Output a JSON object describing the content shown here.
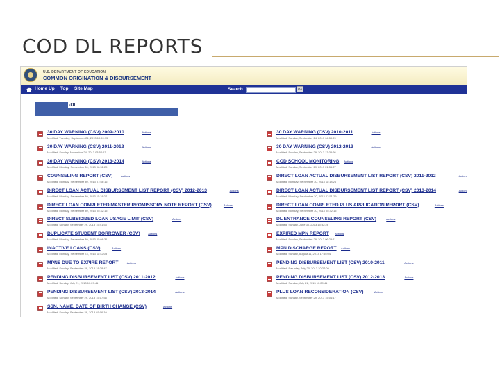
{
  "slide": {
    "title": "COD DL REPORTS"
  },
  "site": {
    "department": "U.S. DEPARTMENT OF EDUCATION",
    "system_name": "COMMON ORIGINATION & DISBURSEMENT",
    "nav": [
      "Home",
      "Up",
      "Top",
      "Site Map"
    ],
    "search_label": "Search",
    "search_value": "",
    "go_label": "Go"
  },
  "section": {
    "title": "-DL"
  },
  "colors": {
    "nav_bar": "#1f3296",
    "link": "#1a2b8c",
    "banner": "#fffbe2",
    "redacted_block": "#3f5fa8",
    "title_rule": "#c8aa6e"
  },
  "icons": {
    "report": "report-doc-icon",
    "home": "home-icon",
    "seal": "department-seal-icon"
  },
  "reports_left": [
    {
      "name": "30 DAY WARNING (CSV) 2009-2010",
      "actions": "Actions",
      "modified": "Modified: Tuesday, September 24, 2013 10:59:15"
    },
    {
      "name": "30 DAY WARNING (CSV) 2011-2012",
      "actions": "Actions",
      "modified": "Modified: Sunday, November 24, 2013 03:54:13"
    },
    {
      "name": "30 DAY WARNING (CSV) 2013-2014",
      "actions": "Actions",
      "modified": "Modified: Monday, September 30, 2013 08:31:29"
    },
    {
      "name": "COUNSELING REPORT (CSV)",
      "actions": "Actions",
      "modified": "Modified: Monday, September 30, 2013 07:58:16"
    },
    {
      "name": "DIRECT LOAN ACTUAL DISBURSEMENT LIST REPORT (CSV) 2012-2013",
      "actions": "Actions",
      "modified": "Modified: Monday, September 30, 2013 11:18:27"
    },
    {
      "name": "DIRECT LOAN COMPLETED MASTER PROMISSORY NOTE REPORT (CSV)",
      "actions": "Actions",
      "modified": "Modified: Monday, September 30, 2013 05:32:15"
    },
    {
      "name": "DIRECT SUBSIDIZED LOAN USAGE LIMIT (CSV)",
      "actions": "Actions",
      "modified": "Modified: Sunday, September 29, 2013 15:41:53"
    },
    {
      "name": "DUPLICATE STUDENT BORROWER (CSV)",
      "actions": "Actions",
      "modified": "Modified: Monday, September 30, 2013 05:08:31"
    },
    {
      "name": "INACTIVE LOANS (CSV)",
      "actions": "Actions",
      "modified": "Modified: Monday, September 23, 2013 11:42:03"
    },
    {
      "name": "MPNS DUE TO EXPIRE REPORT",
      "actions": "Actions",
      "modified": "Modified: Sunday, September 29, 2013 18:28:47"
    },
    {
      "name": "PENDING DISBURSEMENT LIST (CSV) 2011-2012",
      "actions": "Actions",
      "modified": "Modified: Sunday, July 21, 2013 10:29:41"
    },
    {
      "name": "PENDING DISBURSEMENT LIST (CSV) 2013-2014",
      "actions": "Actions",
      "modified": "Modified: Sunday, September 29, 2013 15:17:58"
    },
    {
      "name": "SSN, NAME, DATE OF BIRTH CHANGE (CSV)",
      "actions": "Actions",
      "modified": "Modified: Sunday, September 29, 2013 07:06:10"
    }
  ],
  "reports_right": [
    {
      "name": "30 DAY WARNING (CSV) 2010-2011",
      "actions": "Actions",
      "modified": "Modified: Sunday, September 24, 2013 04:59:29"
    },
    {
      "name": "30 DAY WARNING (CSV) 2012-2013",
      "actions": "Actions",
      "modified": "Modified: Sunday, September 29, 2013 13:35:36"
    },
    {
      "name": "COD SCHOOL MONITORING",
      "actions": "Actions",
      "modified": "Modified: Sunday, September 29, 2013 21:56:27"
    },
    {
      "name": "DIRECT LOAN ACTUAL DISBURSEMENT LIST REPORT (CSV) 2011-2012",
      "actions": "Actions",
      "modified": "Modified: Monday, September 30, 2013 11:18:26"
    },
    {
      "name": "DIRECT LOAN ACTUAL DISBURSEMENT LIST REPORT (CSV) 2013-2014",
      "actions": "Actions",
      "modified": "Modified: Monday, September 30, 2013 07:51:29"
    },
    {
      "name": "DIRECT LOAN COMPLETED PLUS APPLICATION REPORT (CSV)",
      "actions": "Actions",
      "modified": "Modified: Monday, September 30, 2013 05:32:15"
    },
    {
      "name": "DL ENTRANCE COUNSELING REPORT (CSV)",
      "actions": "Actions",
      "modified": "Modified: Sunday, June 30, 2013 15:32:28"
    },
    {
      "name": "EXPIRED MPN REPORT",
      "actions": "Actions",
      "modified": "Modified: Sunday, September 29, 2013 06:29:11"
    },
    {
      "name": "MPN DISCHARGE REPORT",
      "actions": "Actions",
      "modified": "Modified: Sunday, August 11, 2013 17:55:04"
    },
    {
      "name": "PENDING DISBURSEMENT LIST (CSV) 2010-2011",
      "actions": "Actions",
      "modified": "Modified: Saturday, July 20, 2013 10:27:09"
    },
    {
      "name": "PENDING DISBURSEMENT LIST (CSV) 2012-2013",
      "actions": "Actions",
      "modified": "Modified: Sunday, July 21, 2013 10:29:41"
    },
    {
      "name": "PLUS LOAN RECONSIDERATION (CSV)",
      "actions": "Actions",
      "modified": "Modified: Sunday, September 29, 2013 15:01:17"
    }
  ]
}
